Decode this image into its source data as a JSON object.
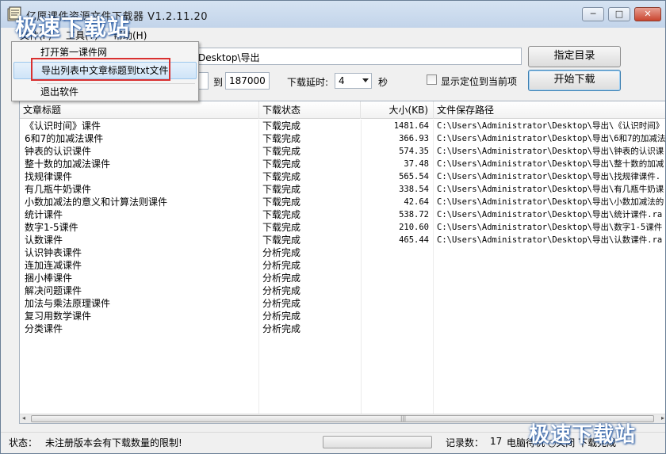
{
  "window": {
    "title": "亿愿课件资源文件下载器 V1.2.11.20",
    "minimize_glyph": "─",
    "maximize_glyph": "□",
    "close_glyph": "✕"
  },
  "watermark": {
    "text": "极速下载站"
  },
  "menu": {
    "file": "文件(F)",
    "tools": "工具(T)",
    "help": "帮助(H)",
    "file_dropdown": {
      "items": [
        "打开第一课件网",
        "导出列表中文章标题到txt文件",
        "退出软件"
      ]
    }
  },
  "controls": {
    "save_path": "Desktop\\导出",
    "set_dir_button": "指定目录",
    "range_to_label": "到",
    "range_end": "187000",
    "delay_label": "下载延时:",
    "delay_value": "4",
    "delay_unit": "秒",
    "show_location_label": "显示定位到当前项",
    "start_button": "开始下载"
  },
  "table": {
    "headers": [
      "文章标题",
      "下载状态",
      "大小(KB)",
      "文件保存路径"
    ],
    "rows": [
      {
        "title": "《认识时间》课件",
        "status": "下载完成",
        "size": "1481.64",
        "path": "C:\\Users\\Administrator\\Desktop\\导出\\《认识时间》"
      },
      {
        "title": "6和7的加减法课件",
        "status": "下载完成",
        "size": "366.93",
        "path": "C:\\Users\\Administrator\\Desktop\\导出\\6和7的加减法"
      },
      {
        "title": "钟表的认识课件",
        "status": "下载完成",
        "size": "574.35",
        "path": "C:\\Users\\Administrator\\Desktop\\导出\\钟表的认识课"
      },
      {
        "title": "整十数的加减法课件",
        "status": "下载完成",
        "size": "37.48",
        "path": "C:\\Users\\Administrator\\Desktop\\导出\\整十数的加减"
      },
      {
        "title": "找规律课件",
        "status": "下载完成",
        "size": "565.54",
        "path": "C:\\Users\\Administrator\\Desktop\\导出\\找规律课件."
      },
      {
        "title": "有几瓶牛奶课件",
        "status": "下载完成",
        "size": "338.54",
        "path": "C:\\Users\\Administrator\\Desktop\\导出\\有几瓶牛奶课"
      },
      {
        "title": "小数加减法的意义和计算法则课件",
        "status": "下载完成",
        "size": "42.64",
        "path": "C:\\Users\\Administrator\\Desktop\\导出\\小数加减法的"
      },
      {
        "title": "统计课件",
        "status": "下载完成",
        "size": "538.72",
        "path": "C:\\Users\\Administrator\\Desktop\\导出\\统计课件.ra"
      },
      {
        "title": "数字1-5课件",
        "status": "下载完成",
        "size": "210.60",
        "path": "C:\\Users\\Administrator\\Desktop\\导出\\数字1-5课件"
      },
      {
        "title": "认数课件",
        "status": "下载完成",
        "size": "465.44",
        "path": "C:\\Users\\Administrator\\Desktop\\导出\\认数课件.ra"
      },
      {
        "title": "认识钟表课件",
        "status": "分析完成",
        "size": "",
        "path": ""
      },
      {
        "title": "连加连减课件",
        "status": "分析完成",
        "size": "",
        "path": ""
      },
      {
        "title": "捆小棒课件",
        "status": "分析完成",
        "size": "",
        "path": ""
      },
      {
        "title": "解决问题课件",
        "status": "分析完成",
        "size": "",
        "path": ""
      },
      {
        "title": "加法与乘法原理课件",
        "status": "分析完成",
        "size": "",
        "path": ""
      },
      {
        "title": "复习用数学课件",
        "status": "分析完成",
        "size": "",
        "path": ""
      },
      {
        "title": "分类课件",
        "status": "分析完成",
        "size": "",
        "path": ""
      }
    ]
  },
  "status": {
    "label": "状态：",
    "message": "未注册版本会有下载数量的限制!",
    "records_label": "记录数：",
    "records_count": "17",
    "after_label": "电脑待机 ○关闭 下载完成"
  }
}
